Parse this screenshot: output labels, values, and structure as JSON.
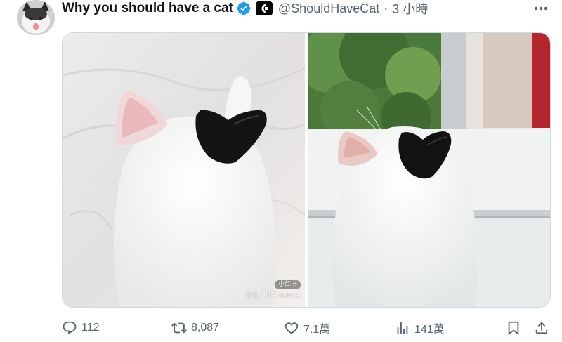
{
  "tweet": {
    "display_name": "Why you should have a cat",
    "handle": "@ShouldHaveCat",
    "separator": "·",
    "time": "3 小時"
  },
  "media": {
    "photo1_watermark_top": "小红书",
    "photo1_watermark_bottom": "小红书ID suww"
  },
  "actions": {
    "replies": "112",
    "reposts": "8,087",
    "likes": "7.1萬",
    "views": "141萬"
  },
  "icons": {
    "reply": "reply-icon",
    "repost": "repost-icon",
    "like": "heart-icon",
    "views": "views-icon",
    "bookmark": "bookmark-icon",
    "share": "share-icon",
    "verified": "verified-badge-icon",
    "more": "more-icon"
  },
  "colors": {
    "verified_blue": "#1d9bf0",
    "muted_text": "#536471",
    "primary_text": "#0f1419"
  }
}
